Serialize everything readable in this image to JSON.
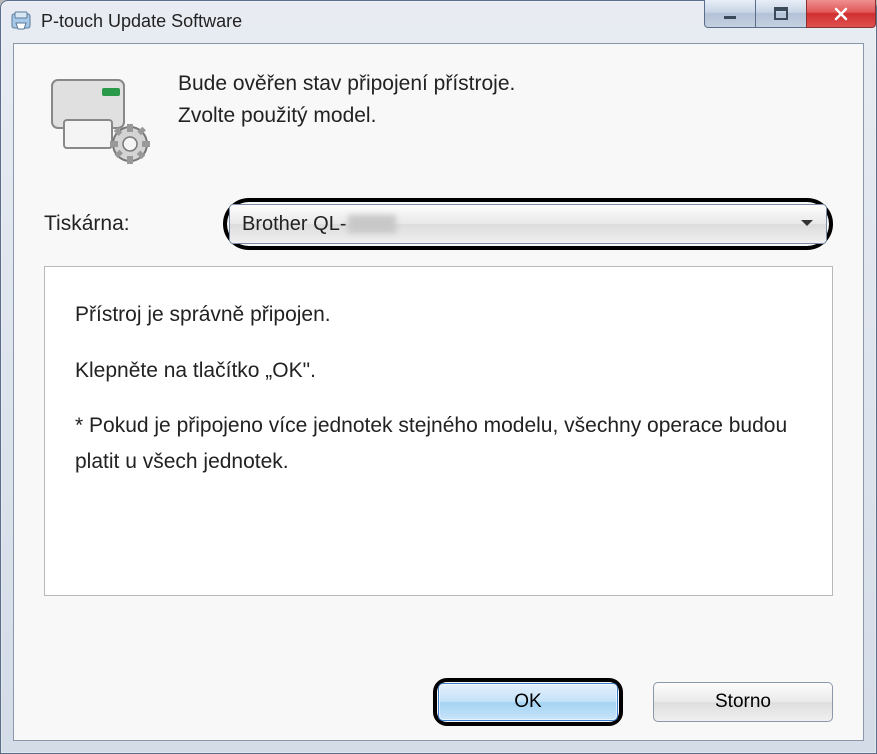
{
  "window": {
    "title": "P-touch Update Software"
  },
  "header": {
    "line1": "Bude ověřen stav připojení přístroje.",
    "line2": "Zvolte použitý model."
  },
  "printerSelect": {
    "label": "Tiskárna:",
    "valuePrefix": "Brother QL-"
  },
  "message": {
    "line1": "Přístroj je správně připojen.",
    "line2": "Klepněte na tlačítko „OK\".",
    "line3": "* Pokud je připojeno více jednotek stejného modelu, všechny operace budou platit u všech jednotek."
  },
  "buttons": {
    "ok": "OK",
    "cancel": "Storno"
  }
}
